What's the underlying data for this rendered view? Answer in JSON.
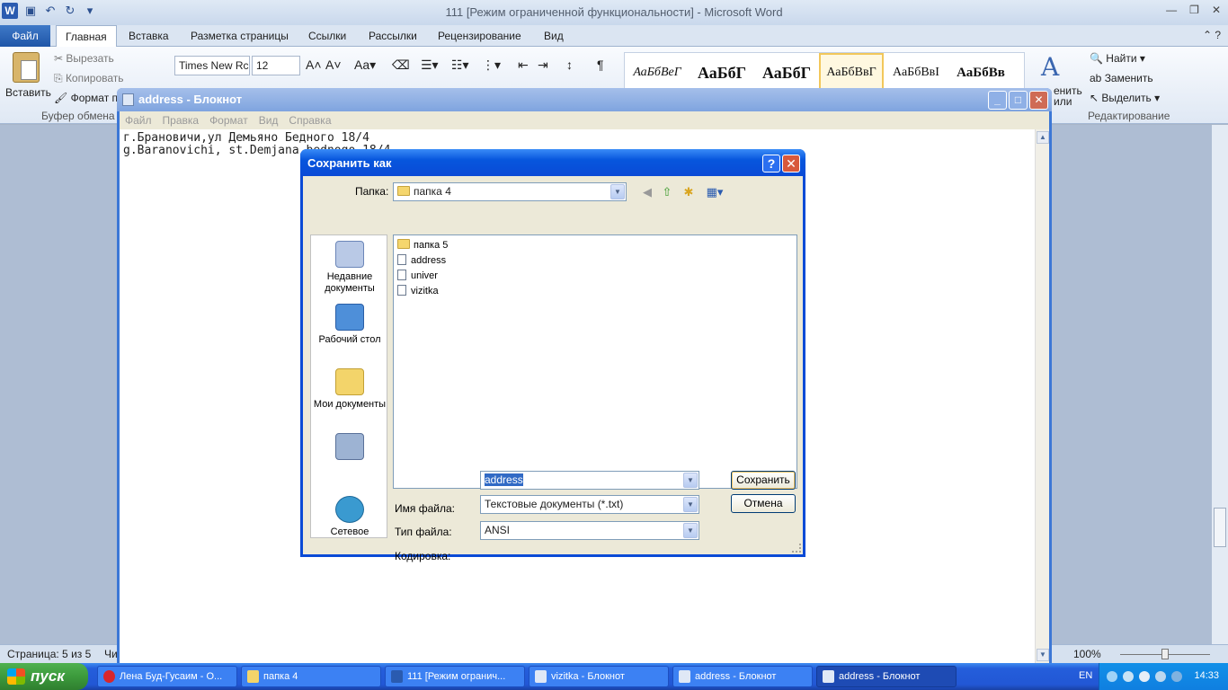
{
  "word": {
    "title": "111 [Режим ограниченной функциональности]  -  Microsoft Word",
    "tabs": [
      "Файл",
      "Главная",
      "Вставка",
      "Разметка страницы",
      "Ссылки",
      "Рассылки",
      "Рецензирование",
      "Вид"
    ],
    "clipboard": {
      "paste": "Вставить",
      "cut": "Вырезать",
      "copy": "Копировать",
      "format": "Формат п",
      "group": "Буфер обмена"
    },
    "font": {
      "name": "Times New Rc",
      "size": "12"
    },
    "styles": [
      "АаБбВеГ",
      "АаБбГ",
      "АаБбГ",
      "АаБбВвГ",
      "АаБбВвI",
      "АаБбВв"
    ],
    "editing": {
      "find": "Найти",
      "replace": "Заменить",
      "select": "Выделить",
      "group": "Редактирование",
      "change_frag": "енить",
      "change_frag2": "или"
    },
    "status": {
      "page": "Страница: 5 из 5",
      "words_frag": "Чи",
      "zoom": "100%"
    }
  },
  "notepad": {
    "title": "address - Блокнот",
    "menu": [
      "Файл",
      "Правка",
      "Формат",
      "Вид",
      "Справка"
    ],
    "lines": [
      "г.Брановичи,ул Демьяно Бедного 18/4",
      "g.Baranovichi, st.Demjana bednogo 18/4"
    ]
  },
  "dialog": {
    "title": "Сохранить как",
    "folder_label": "Папка:",
    "folder_value": "папка 4",
    "places": [
      "Недавние документы",
      "Рабочий стол",
      "Мои документы",
      "",
      "Сетевое"
    ],
    "files": [
      {
        "name": "папка 5",
        "kind": "folder"
      },
      {
        "name": "address",
        "kind": "file"
      },
      {
        "name": "univer",
        "kind": "file"
      },
      {
        "name": "vizitka",
        "kind": "file"
      }
    ],
    "filename_label": "Имя файла:",
    "filename_value": "address",
    "filetype_label": "Тип файла:",
    "filetype_value": "Текстовые документы (*.txt)",
    "encoding_label": "Кодировка:",
    "encoding_value": "ANSI",
    "save_label": "Сохранить",
    "cancel_label": "Отмена"
  },
  "taskbar": {
    "start_label": "пуск",
    "tasks": [
      "Лена Буд-Гусаим - О...",
      "папка 4",
      "111 [Режим огранич...",
      "vizitka - Блокнот",
      "address - Блокнот",
      "address - Блокнот"
    ],
    "lang": "EN",
    "time": "14:33"
  }
}
